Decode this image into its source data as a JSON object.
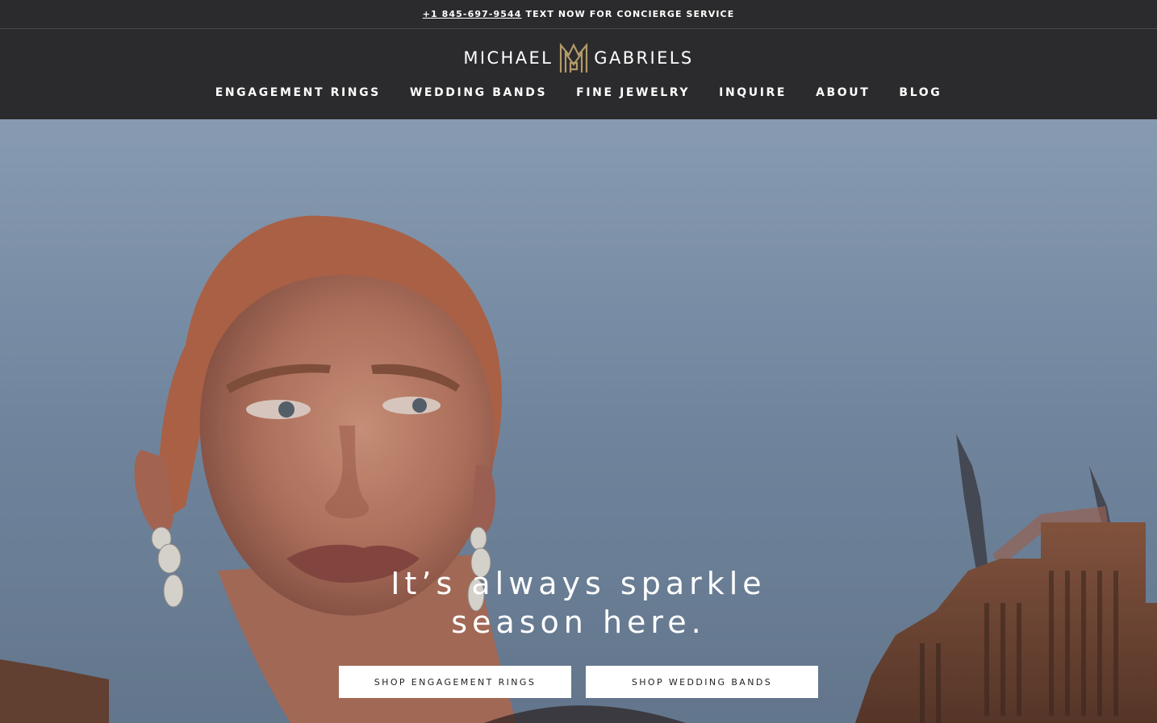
{
  "topbar": {
    "phone": "+1 845-697-9544",
    "message": "TEXT NOW FOR CONCIERGE SERVICE"
  },
  "logo": {
    "left_text": "MICHAEL",
    "right_text": "GABRIELS",
    "monogram_color": "#b39a6a"
  },
  "nav": {
    "items": [
      {
        "label": "ENGAGEMENT RINGS"
      },
      {
        "label": "WEDDING BANDS"
      },
      {
        "label": "FINE JEWELRY"
      },
      {
        "label": "INQUIRE"
      },
      {
        "label": "ABOUT"
      },
      {
        "label": "BLOG"
      }
    ]
  },
  "hero": {
    "headline_line1": "It’s always sparkle",
    "headline_line2": "season here.",
    "cta_primary": "SHOP ENGAGEMENT RINGS",
    "cta_secondary": "SHOP WEDDING BANDS"
  },
  "colors": {
    "header_bg": "#2b2a2c",
    "button_bg": "#ffffff",
    "gold": "#b39a6a"
  }
}
